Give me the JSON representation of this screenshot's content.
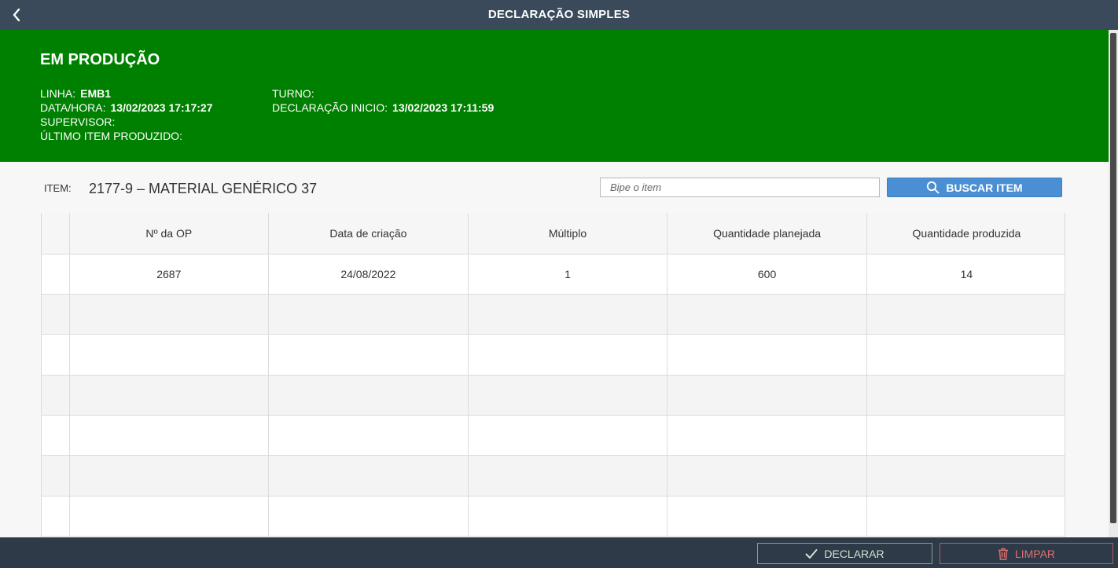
{
  "header": {
    "title": "DECLARAÇÃO SIMPLES",
    "back_icon": "chevron-left-icon"
  },
  "status": {
    "label": "EM PRODUÇÃO",
    "color": "#008000",
    "linha_label": "LINHA:",
    "linha_value": "EMB1",
    "datahora_label": "DATA/HORA:",
    "datahora_value": "13/02/2023 17:17:27",
    "supervisor_label": "SUPERVISOR:",
    "ultimo_item_label": "ÚLTIMO ITEM PRODUZIDO:",
    "turno_label": "TURNO:",
    "declaracao_inicio_label": "DECLARAÇÃO INICIO:",
    "declaracao_inicio_value": "13/02/2023 17:11:59"
  },
  "item": {
    "label": "ITEM:",
    "value": "2177-9 – MATERIAL GENÉRICO 37"
  },
  "search": {
    "placeholder": "Bipe o item",
    "button_label": "BUSCAR ITEM",
    "button_icon": "search-icon"
  },
  "table": {
    "columns": [
      "Nº da OP",
      "Data de criação",
      "Múltiplo",
      "Quantidade planejada",
      "Quantidade produzida"
    ],
    "rows": [
      [
        "2687",
        "24/08/2022",
        "1",
        "600",
        "14"
      ],
      [
        "",
        "",
        "",
        "",
        ""
      ],
      [
        "",
        "",
        "",
        "",
        ""
      ],
      [
        "",
        "",
        "",
        "",
        ""
      ],
      [
        "",
        "",
        "",
        "",
        ""
      ],
      [
        "",
        "",
        "",
        "",
        ""
      ],
      [
        "",
        "",
        "",
        "",
        ""
      ]
    ]
  },
  "footer": {
    "declarar_label": "DECLARAR",
    "declarar_icon": "checkmark-icon",
    "limpar_label": "LIMPAR",
    "limpar_icon": "trash-icon"
  }
}
